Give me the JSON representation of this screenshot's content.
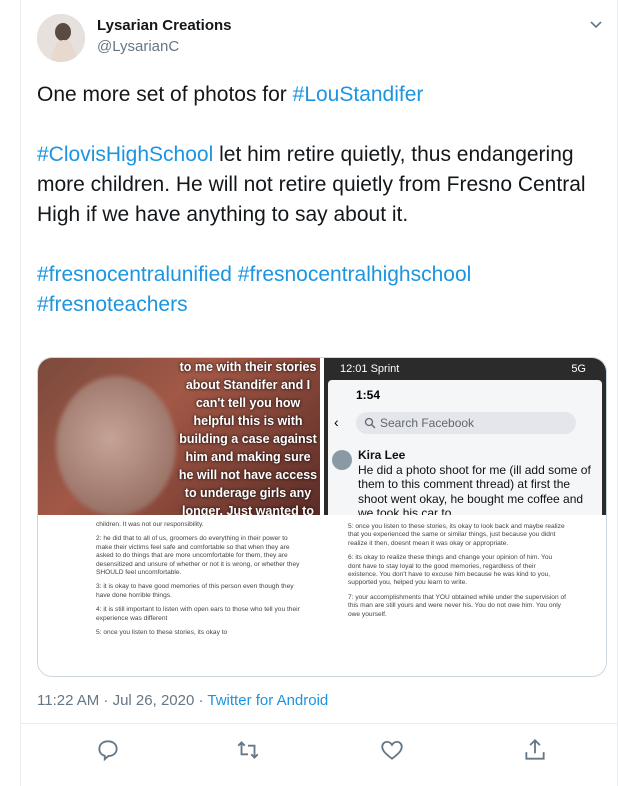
{
  "author": {
    "name": "Lysarian Creations",
    "handle": "@LysarianC"
  },
  "tweet": {
    "lines": [
      {
        "prefix": "One more set of photos for ",
        "tag": "#LouStandifer",
        "suffix": ""
      },
      {
        "prefix": "",
        "tag": "#ClovisHighSchool",
        "suffix": " let him retire quietly,  thus endangering more children. He will not retire quietly from Fresno Central High if we have anything to say about it."
      },
      {
        "prefix": "",
        "tag": "#fresnocentralunified",
        "suffix": ""
      }
    ],
    "tags_line3_b": "#fresnocentralhighschool",
    "tags_line3_c": "#fresnoteachers"
  },
  "media": {
    "photo1_text": "to me with their stories about Standifer and I can't tell you how helpful this is with building a case against him and making sure he will not have access to underage girls any longer. Just wanted to say I am still here for anyone to come talk to",
    "photo2": {
      "status_time": "12:01 Sprint",
      "status_right": "5G",
      "inner_time": "1:54",
      "search_placeholder": "Search Facebook",
      "comment_author": "Kira Lee",
      "comment_text": "He did a photo shoot for me (ill add some of them to this comment thread) at first the shoot went okay, he bought me coffee and we took his car to"
    },
    "photo3": {
      "p1": "children. It was not our responsibility.",
      "p2": "2: he did that to all of us, groomers do everything in their power to make their victims feel safe and comfortable so that when they are asked to do things that are more uncomfortable for them, they are desensitized and unsure of whether or not it is wrong, or whether they SHOULD feel uncomfortable.",
      "p3": "3: it is okay to have good memories of this person even though they have done horrible things.",
      "p4": "4: it is still important to listen with open ears to those who tell you their experience was different",
      "p5": "5: once you listen to these stories, its okay to"
    },
    "photo4": {
      "p1": "5: once you listen to these stories, its okay to look back and maybe realize that you experienced the same or similar things, just because you didnt realize it then, doesnt mean it was okay or appropriate.",
      "p2": "6: its okay to realize these things and change your opinion of him. You dont have to stay loyal to the good memories, regardless of their existence. You don't have to excuse him because he was kind to you, supported you, helped you learn to write.",
      "p3": "7: your accomplishments that YOU obtained while under the supervision of this man are still yours and were never his. You do not owe him. You only owe yourself."
    }
  },
  "meta": {
    "time": "11:22 AM · Jul 26, 2020 · ",
    "source": "Twitter for Android"
  },
  "colors": {
    "link": "#1b95e0",
    "muted": "#657786",
    "border": "#e6ecf0"
  },
  "icons": [
    "chevron-down-icon",
    "reply-icon",
    "retweet-icon",
    "like-icon",
    "share-icon"
  ]
}
